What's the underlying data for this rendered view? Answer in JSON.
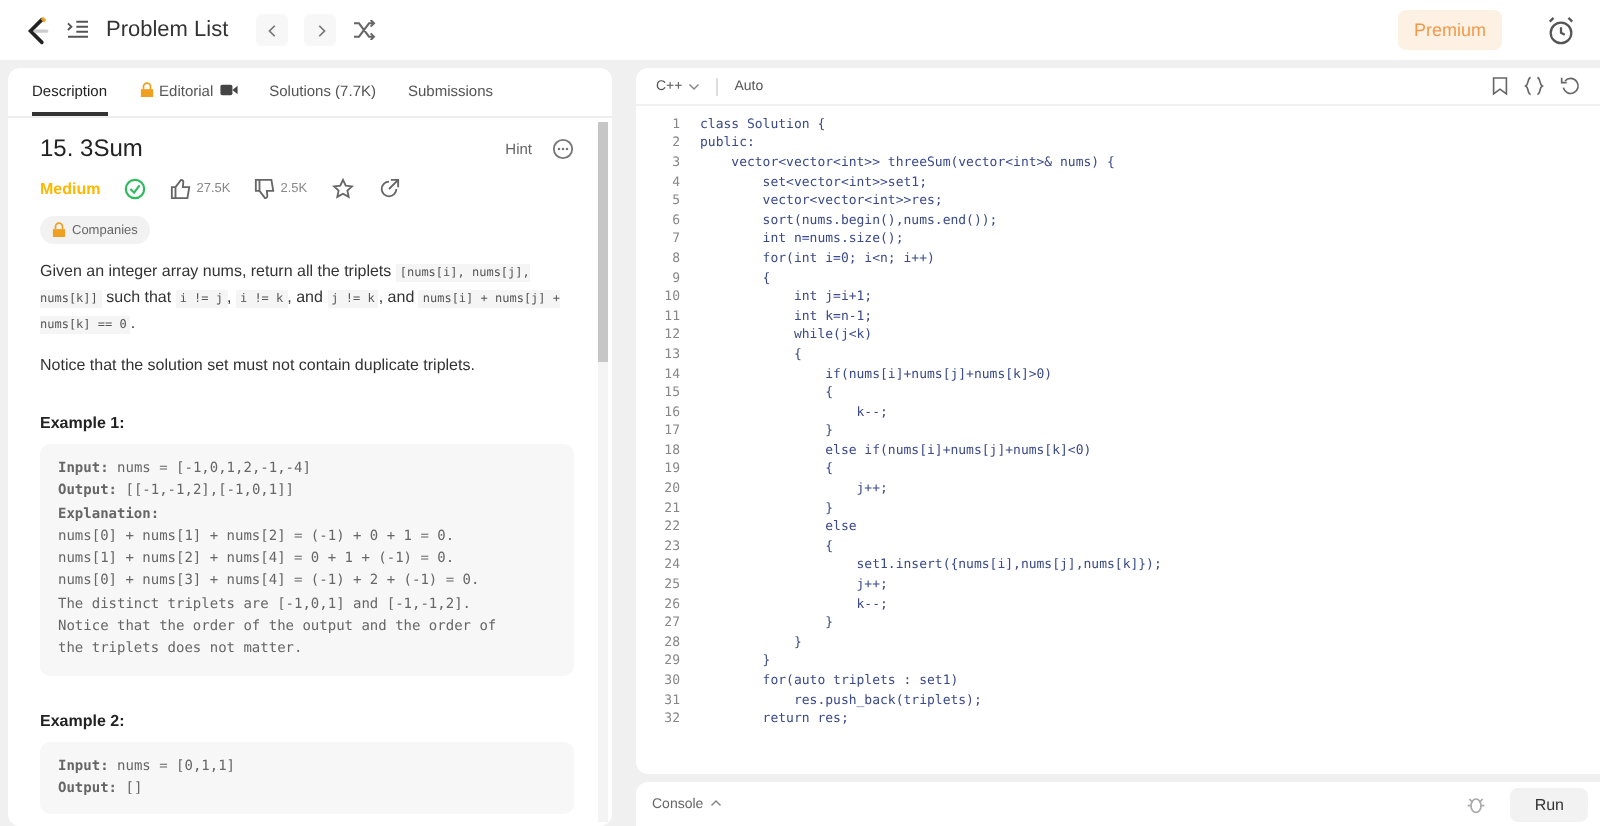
{
  "topbar": {
    "title": "Problem List",
    "premium": "Premium"
  },
  "tabs": [
    {
      "label": "Description",
      "selected": true,
      "kind": "plain"
    },
    {
      "label": "Editorial",
      "selected": false,
      "kind": "locked"
    },
    {
      "label": "Solutions (7.7K)",
      "selected": false,
      "kind": "plain"
    },
    {
      "label": "Submissions",
      "selected": false,
      "kind": "plain"
    }
  ],
  "problem": {
    "title": "15. 3Sum",
    "hint": "Hint",
    "difficulty": "Medium",
    "solved": true,
    "likes": "27.5K",
    "dislikes": "2.5K",
    "companies": "Companies",
    "paragraphs": [
      [
        {
          "text": "Given an integer array nums, return all the triplets ",
          "code": false
        },
        {
          "text": "[nums[i], nums[j], nums[k]]",
          "code": true
        },
        {
          "text": " such that ",
          "code": false
        },
        {
          "text": "i != j",
          "code": true
        },
        {
          "text": ", ",
          "code": false
        },
        {
          "text": "i != k",
          "code": true
        },
        {
          "text": ", and ",
          "code": false
        },
        {
          "text": "j != k",
          "code": true
        },
        {
          "text": ", and ",
          "code": false
        },
        {
          "text": "nums[i] + nums[j] + nums[k] == 0",
          "code": true
        },
        {
          "text": ".",
          "code": false
        }
      ],
      [
        {
          "text": "Notice that the solution set must not contain duplicate triplets.",
          "code": false
        }
      ]
    ],
    "examples": [
      {
        "title": "Example 1:",
        "lines": [
          "**Input:** nums = [-1,0,1,2,-1,-4]",
          "**Output:** [[-1,-1,2],[-1,0,1]]",
          "**Explanation:**",
          "nums[0] + nums[1] + nums[2] = (-1) + 0 + 1 = 0.",
          "nums[1] + nums[2] + nums[4] = 0 + 1 + (-1) = 0.",
          "nums[0] + nums[3] + nums[4] = (-1) + 2 + (-1) = 0.",
          "The distinct triplets are [-1,0,1] and [-1,-1,2].",
          "Notice that the order of the output and the order of",
          "the triplets does not matter."
        ]
      },
      {
        "title": "Example 2:",
        "lines": [
          "**Input:** nums = [0,1,1]",
          "**Output:** []"
        ]
      }
    ]
  },
  "editor": {
    "language": "C++",
    "mode": "Auto",
    "lines": [
      {
        "number": "1",
        "text": "class Solution {"
      },
      {
        "number": "2",
        "text": "public:"
      },
      {
        "number": "3",
        "text": "    vector<vector<int>> threeSum(vector<int>& nums) {"
      },
      {
        "number": "4",
        "text": "        set<vector<int>>set1;"
      },
      {
        "number": "5",
        "text": "        vector<vector<int>>res;"
      },
      {
        "number": "6",
        "text": "        sort(nums.begin(),nums.end());"
      },
      {
        "number": "7",
        "text": "        int n=nums.size();"
      },
      {
        "number": "8",
        "text": "        for(int i=0; i<n; i++)"
      },
      {
        "number": "9",
        "text": "        {"
      },
      {
        "number": "10",
        "text": "            int j=i+1;"
      },
      {
        "number": "11",
        "text": "            int k=n-1;"
      },
      {
        "number": "12",
        "text": "            while(j<k)"
      },
      {
        "number": "13",
        "text": "            {"
      },
      {
        "number": "14",
        "text": "                if(nums[i]+nums[j]+nums[k]>0)"
      },
      {
        "number": "15",
        "text": "                {"
      },
      {
        "number": "16",
        "text": "                    k--;"
      },
      {
        "number": "17",
        "text": "                }"
      },
      {
        "number": "18",
        "text": "                else if(nums[i]+nums[j]+nums[k]<0)"
      },
      {
        "number": "19",
        "text": "                {"
      },
      {
        "number": "20",
        "text": "                    j++;"
      },
      {
        "number": "21",
        "text": "                }"
      },
      {
        "number": "22",
        "text": "                else"
      },
      {
        "number": "23",
        "text": "                {"
      },
      {
        "number": "24",
        "text": "                    set1.insert({nums[i],nums[j],nums[k]});"
      },
      {
        "number": "25",
        "text": "                    j++;"
      },
      {
        "number": "26",
        "text": "                    k--;"
      },
      {
        "number": "27",
        "text": "                }"
      },
      {
        "number": "28",
        "text": "            }"
      },
      {
        "number": "29",
        "text": "        }"
      },
      {
        "number": "30",
        "text": "        for(auto triplets : set1)"
      },
      {
        "number": "31",
        "text": "            res.push_back(triplets);"
      },
      {
        "number": "32",
        "text": "        return res;"
      }
    ]
  },
  "console": {
    "label": "Console",
    "run": "Run"
  }
}
